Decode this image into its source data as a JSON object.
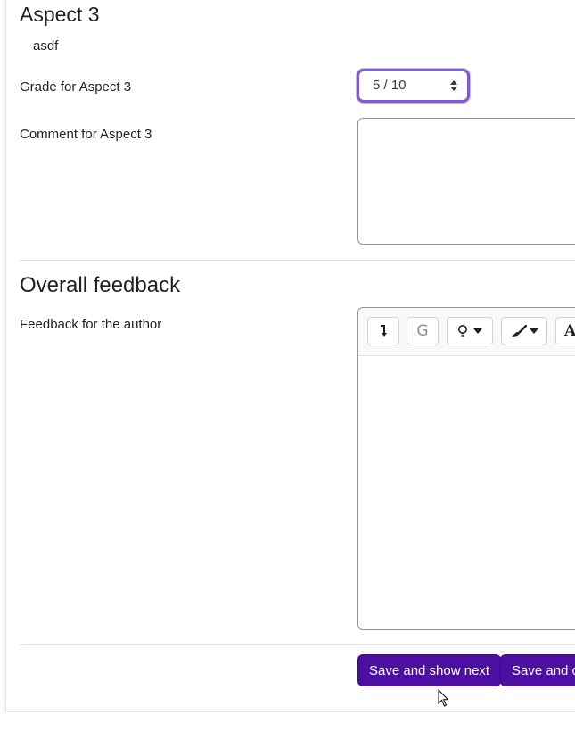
{
  "aspect": {
    "title": "Aspect 3",
    "description": "asdf",
    "grade_label": "Grade for Aspect 3",
    "grade_value": "5 / 10",
    "comment_label": "Comment for Aspect 3",
    "comment_value": ""
  },
  "overall": {
    "title": "Overall feedback",
    "feedback_label": "Feedback for the author",
    "feedback_value": "",
    "toolbar": {
      "g_label": "G",
      "a_label": "A"
    }
  },
  "actions": {
    "save_next_label": "Save and show next",
    "save_continue_label": "Save and c"
  },
  "colors": {
    "primary": "#4c0fa1",
    "focus_ring": "#7a5dd0"
  }
}
